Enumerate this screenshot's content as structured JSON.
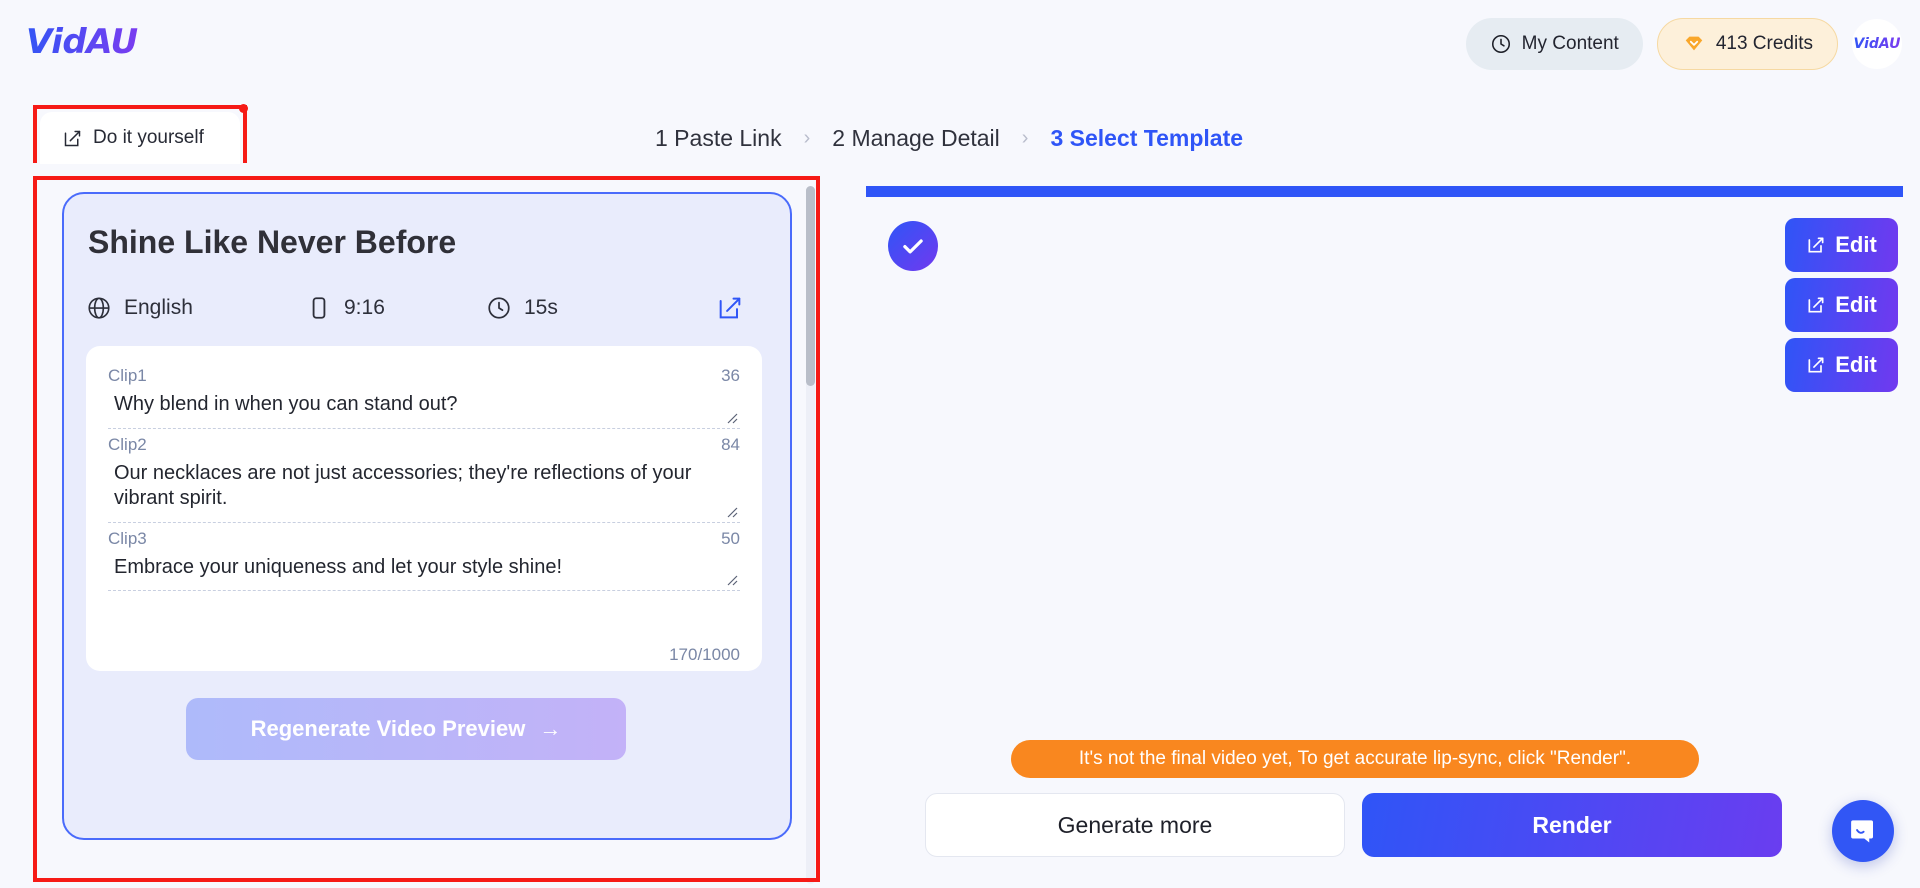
{
  "brand": {
    "logo_text": "VidAU",
    "avatar_text": "VidAU"
  },
  "header": {
    "my_content_label": "My Content",
    "my_content_icon": "clock-icon",
    "credits_label": "413 Credits",
    "credits_icon": "diamond-icon"
  },
  "steps": [
    {
      "label": "1 Paste Link",
      "active": false
    },
    {
      "label": "2 Manage Detail",
      "active": false
    },
    {
      "label": "3 Select Template",
      "active": true
    }
  ],
  "step_separator": "›",
  "left": {
    "tab_label": "Do it yourself",
    "tab_icon": "edit-square-icon",
    "panel_title": "Shine Like Never Before",
    "meta": [
      {
        "icon": "globe-icon",
        "value": "English"
      },
      {
        "icon": "phone-portrait-icon",
        "value": "9:16"
      },
      {
        "icon": "clock-icon",
        "value": "15s"
      }
    ],
    "meta_edit_icon": "edit-square-icon",
    "clips": [
      {
        "label": "Clip1",
        "count": "36",
        "text": "Why blend in when you can stand out?"
      },
      {
        "label": "Clip2",
        "count": "84",
        "text": " Our necklaces are not just accessories; they're reflections of your vibrant spirit."
      },
      {
        "label": "Clip3",
        "count": "50",
        "text": "Embrace your uniqueness and let your style shine!"
      }
    ],
    "char_count": "170/1000",
    "regenerate_label": "Regenerate Video Preview",
    "regenerate_arrow": "→"
  },
  "right": {
    "selected_icon": "check-circle-icon",
    "edit_buttons": [
      {
        "label": "Edit",
        "icon": "edit-square-icon"
      },
      {
        "label": "Edit",
        "icon": "edit-square-icon"
      },
      {
        "label": "Edit",
        "icon": "edit-square-icon"
      }
    ],
    "notice": "It's not the final video yet, To get accurate lip-sync, click \"Render\".",
    "generate_more_label": "Generate more",
    "render_label": "Render"
  },
  "chat": {
    "icon": "chat-bubble-icon"
  },
  "colors": {
    "accent_blue": "#2f55f7",
    "accent_purple": "#7139ef",
    "notice_orange": "#f9871f",
    "annotation_red": "#f61a16",
    "panel_bg": "#e9ecfc",
    "page_bg": "#f7f8fd"
  }
}
